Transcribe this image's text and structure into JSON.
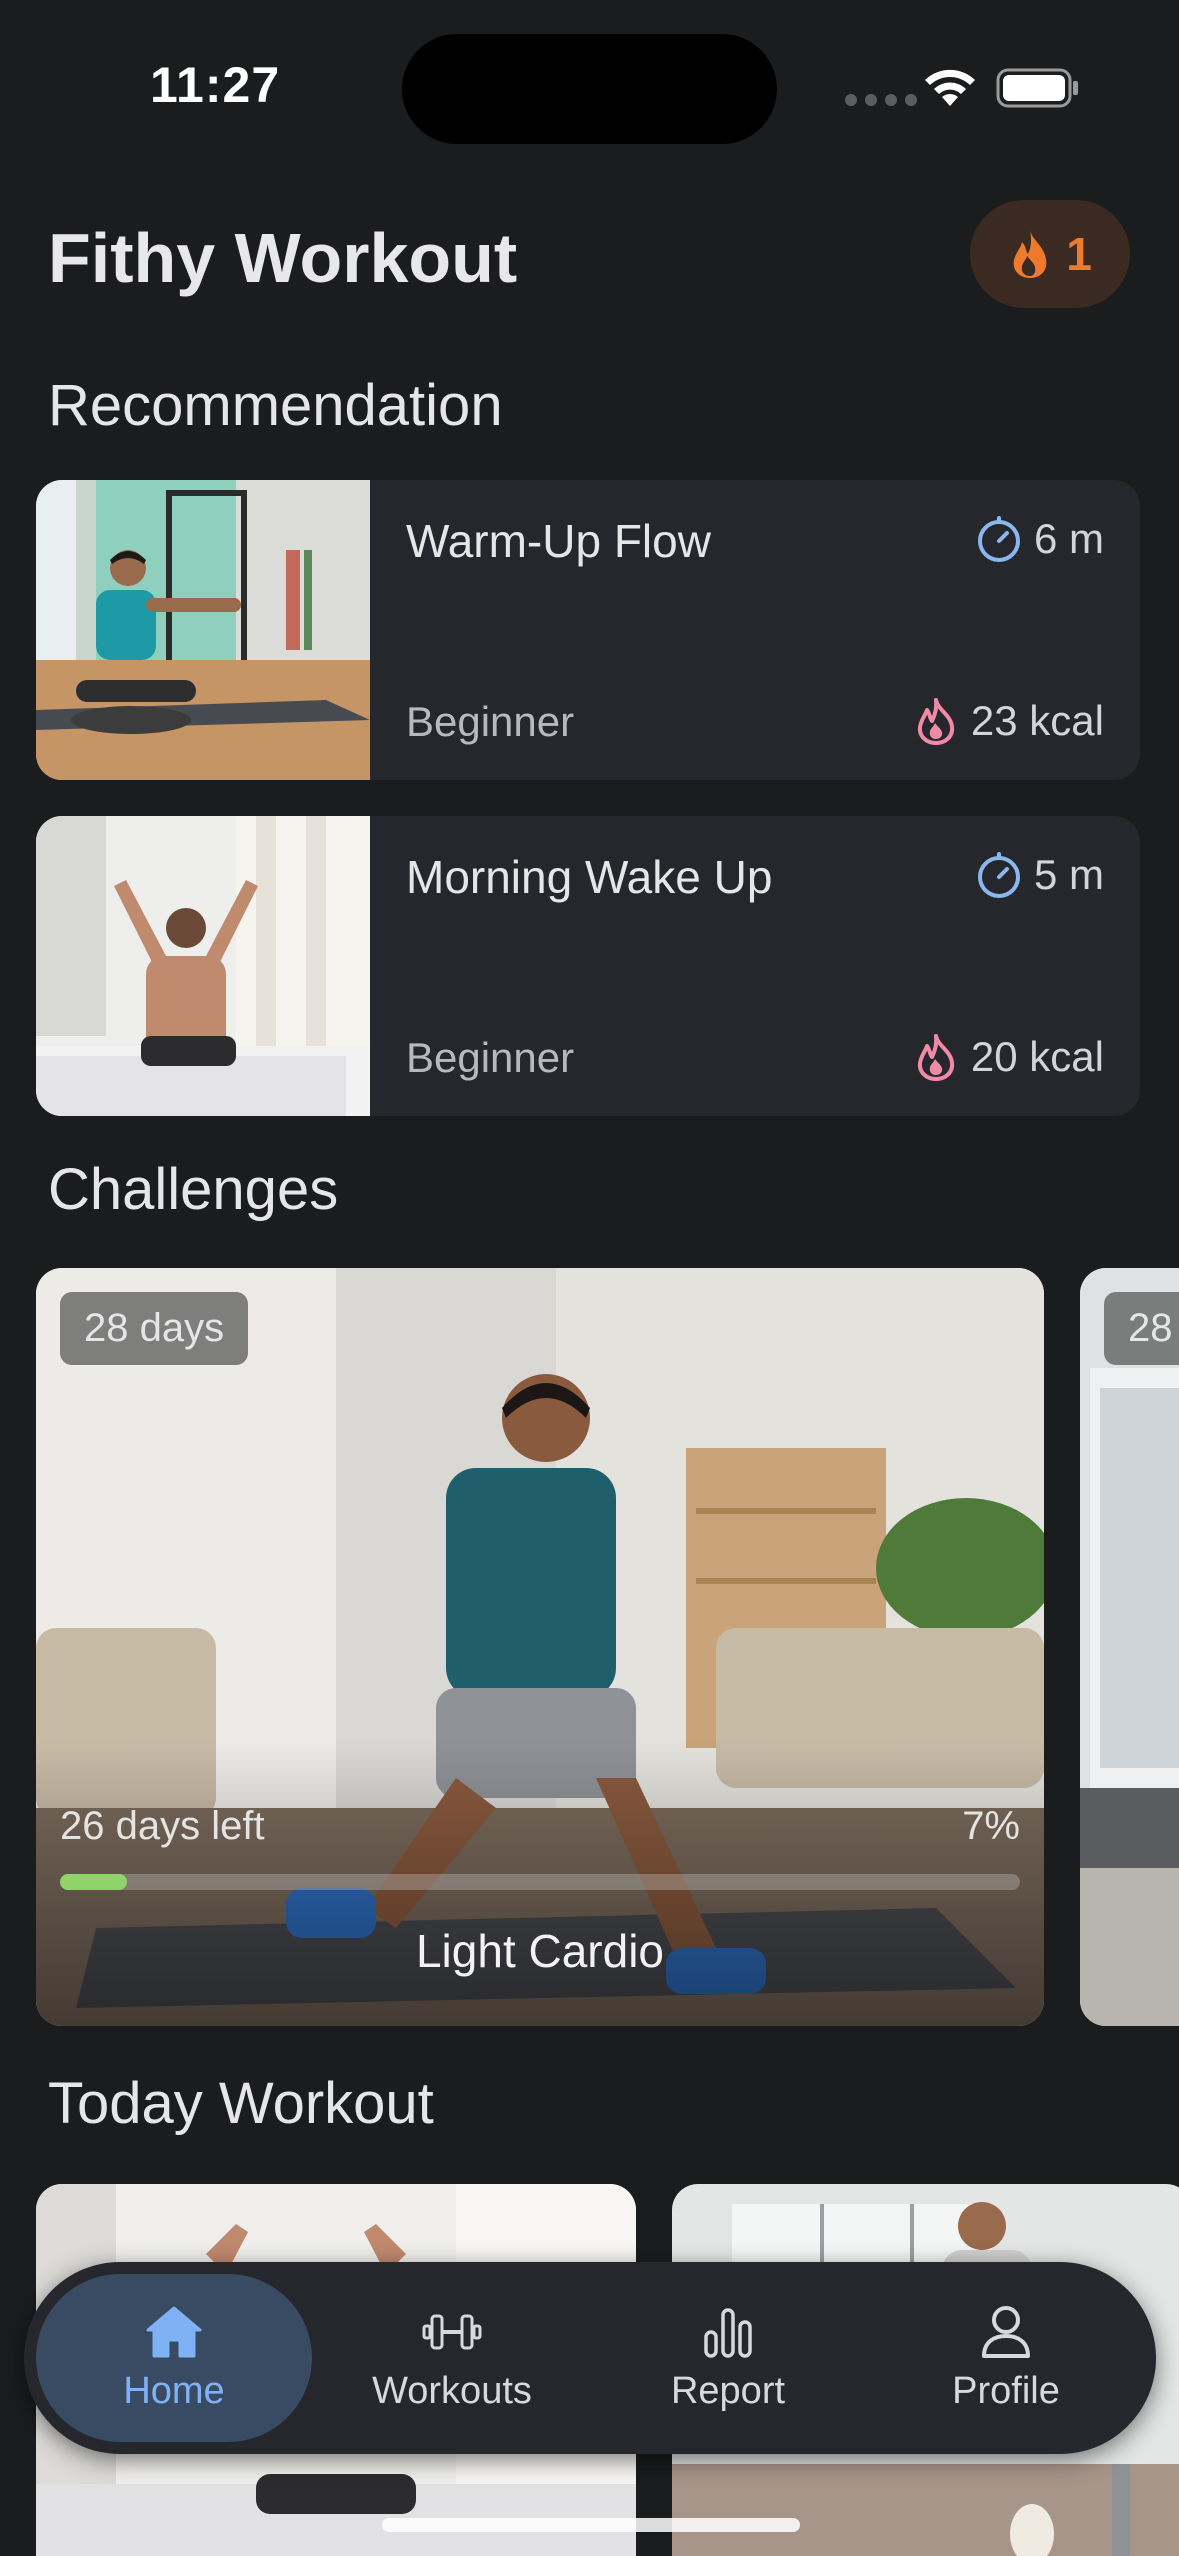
{
  "status_bar": {
    "time": "11:27"
  },
  "header": {
    "title": "Fithy Workout",
    "streak_count": "1"
  },
  "sections": {
    "recommendation": "Recommendation",
    "challenges": "Challenges",
    "today_workout": "Today Workout"
  },
  "recommendations": [
    {
      "name": "Warm-Up Flow",
      "duration": "6 m",
      "level": "Beginner",
      "kcal": "23 kcal"
    },
    {
      "name": "Morning Wake Up",
      "duration": "5 m",
      "level": "Beginner",
      "kcal": "20 kcal"
    }
  ],
  "challenges": [
    {
      "days": "28 days",
      "days_left": "26 days left",
      "progress_text": "7%",
      "progress": 0.07,
      "name": "Light Cardio"
    },
    {
      "days": "28"
    }
  ],
  "nav": {
    "items": [
      {
        "label": "Home",
        "icon": "home-icon",
        "active": true
      },
      {
        "label": "Workouts",
        "icon": "dumbbell-icon",
        "active": false
      },
      {
        "label": "Report",
        "icon": "bar-chart-icon",
        "active": false
      },
      {
        "label": "Profile",
        "icon": "user-icon",
        "active": false
      }
    ]
  },
  "colors": {
    "background": "#1b1c1e",
    "card": "#25272d",
    "accent_blue": "#7fb2f5",
    "streak_orange": "#f07a2c",
    "progress_green": "#8fd46b",
    "kcal_pink": "#f08aa8",
    "timer_blue": "#8ab8ee"
  }
}
